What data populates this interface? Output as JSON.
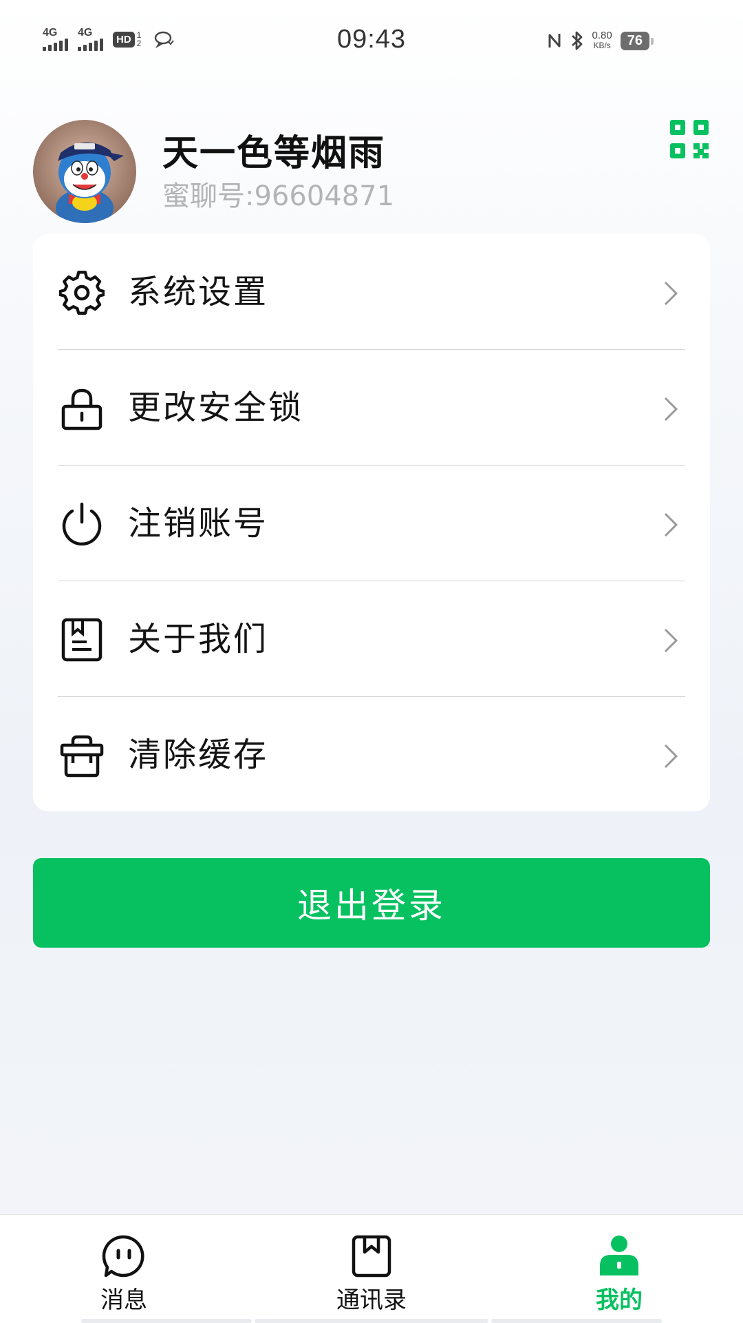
{
  "status_bar": {
    "signal_1": "4G",
    "signal_2": "4G",
    "hd_label": "HD",
    "hd_sup": "1",
    "hd_sub": "2",
    "time": "09:43",
    "net_speed_value": "0.80",
    "net_speed_unit": "KB/s",
    "battery": "76",
    "icons": [
      "chat-bubble-icon",
      "nfc-icon",
      "bluetooth-icon"
    ]
  },
  "profile": {
    "name": "天一色等烟雨",
    "id_text": "蜜聊号:96604871",
    "qr_icon": "qr-code-icon"
  },
  "menu": {
    "items": [
      {
        "label": "系统设置",
        "icon": "gear-icon"
      },
      {
        "label": "更改安全锁",
        "icon": "lock-icon"
      },
      {
        "label": "注销账号",
        "icon": "power-icon"
      },
      {
        "label": "关于我们",
        "icon": "bookmark-doc-icon"
      },
      {
        "label": "清除缓存",
        "icon": "basket-icon"
      }
    ]
  },
  "logout": {
    "label": "退出登录"
  },
  "bottom_nav": {
    "items": [
      {
        "label": "消息",
        "icon": "chat-face-icon",
        "active": false
      },
      {
        "label": "通讯录",
        "icon": "contacts-book-icon",
        "active": false
      },
      {
        "label": "我的",
        "icon": "user-icon",
        "active": true
      }
    ]
  },
  "colors": {
    "accent": "#07c160",
    "text_primary": "#111111",
    "text_secondary": "#b4b4b4",
    "divider": "#d5d5d5"
  }
}
